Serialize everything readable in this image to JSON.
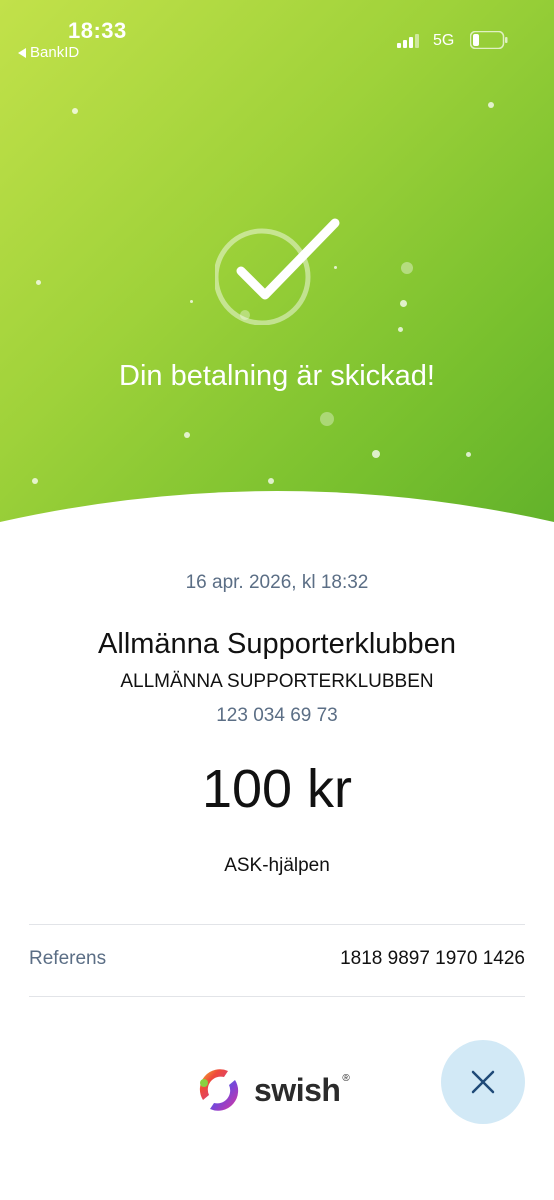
{
  "status_bar": {
    "time": "18:33",
    "back_label": "BankID",
    "network": "5G"
  },
  "hero": {
    "title": "Din betalning är skickad!",
    "icon": "check-circle-icon",
    "colors": {
      "gradient_start": "#c2e14a",
      "gradient_end": "#5fb02a"
    }
  },
  "receipt": {
    "date": "16 apr. 2026, kl 18:32",
    "payee_name": "Allmänna Supporterklubben",
    "payee_org": "ALLMÄNNA SUPPORTERKLUBBEN",
    "payee_number": "123 034 69 73",
    "amount": "100 kr",
    "message": "ASK-hjälpen",
    "reference_label": "Referens",
    "reference_value": "1818 9897 1970 1426"
  },
  "footer": {
    "logo_text": "swish",
    "logo_reg": "®",
    "close_icon": "close-icon",
    "close_button_color": "#d2e9f6"
  }
}
